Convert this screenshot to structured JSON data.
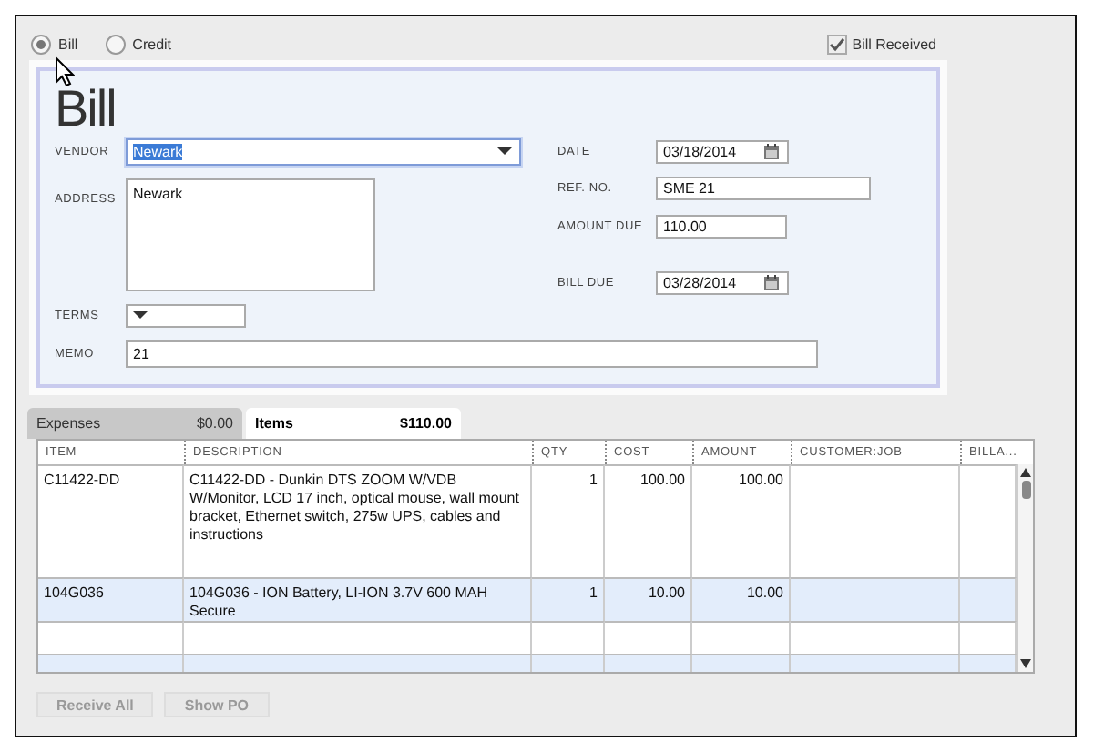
{
  "bill_type": [
    {
      "label": "Bill",
      "selected": true
    },
    {
      "label": "Credit",
      "selected": false
    }
  ],
  "bill_received": {
    "label": "Bill Received",
    "checked": true
  },
  "form": {
    "title": "Bill",
    "vendor": {
      "label": "VENDOR",
      "value": "Newark"
    },
    "address": {
      "label": "ADDRESS",
      "value": "Newark"
    },
    "terms": {
      "label": "TERMS"
    },
    "memo": {
      "label": "MEMO",
      "value": "21"
    },
    "date": {
      "label": "DATE",
      "value": "03/18/2014"
    },
    "ref_no": {
      "label": "REF. NO.",
      "value": "SME 21"
    },
    "amount_due": {
      "label": "AMOUNT DUE",
      "value": "110.00"
    },
    "bill_due": {
      "label": "BILL DUE",
      "value": "03/28/2014"
    }
  },
  "tabs": [
    {
      "label": "Expenses",
      "amount": "$0.00",
      "selected": false
    },
    {
      "label": "Items",
      "amount": "$110.00",
      "selected": true
    }
  ],
  "table": {
    "columns": [
      "ITEM",
      "DESCRIPTION",
      "QTY",
      "COST",
      "AMOUNT",
      "CUSTOMER:JOB",
      "BILLA..."
    ],
    "rows": [
      {
        "cells": [
          "C11422-DD",
          "C11422-DD - Dunkin DTS ZOOM W/VDB W/Monitor, LCD 17 inch, optical mouse, wall mount bracket, Ethernet switch, 275w UPS, cables and instructions",
          "1",
          "100.00",
          "100.00"
        ]
      },
      {
        "cells": [
          "104G036",
          "104G036 - ION Battery, LI-ION 3.7V 600 MAH Secure",
          "1",
          "10.00",
          "10.00"
        ]
      }
    ]
  },
  "buttons": [
    "Receive All",
    "Show PO"
  ]
}
